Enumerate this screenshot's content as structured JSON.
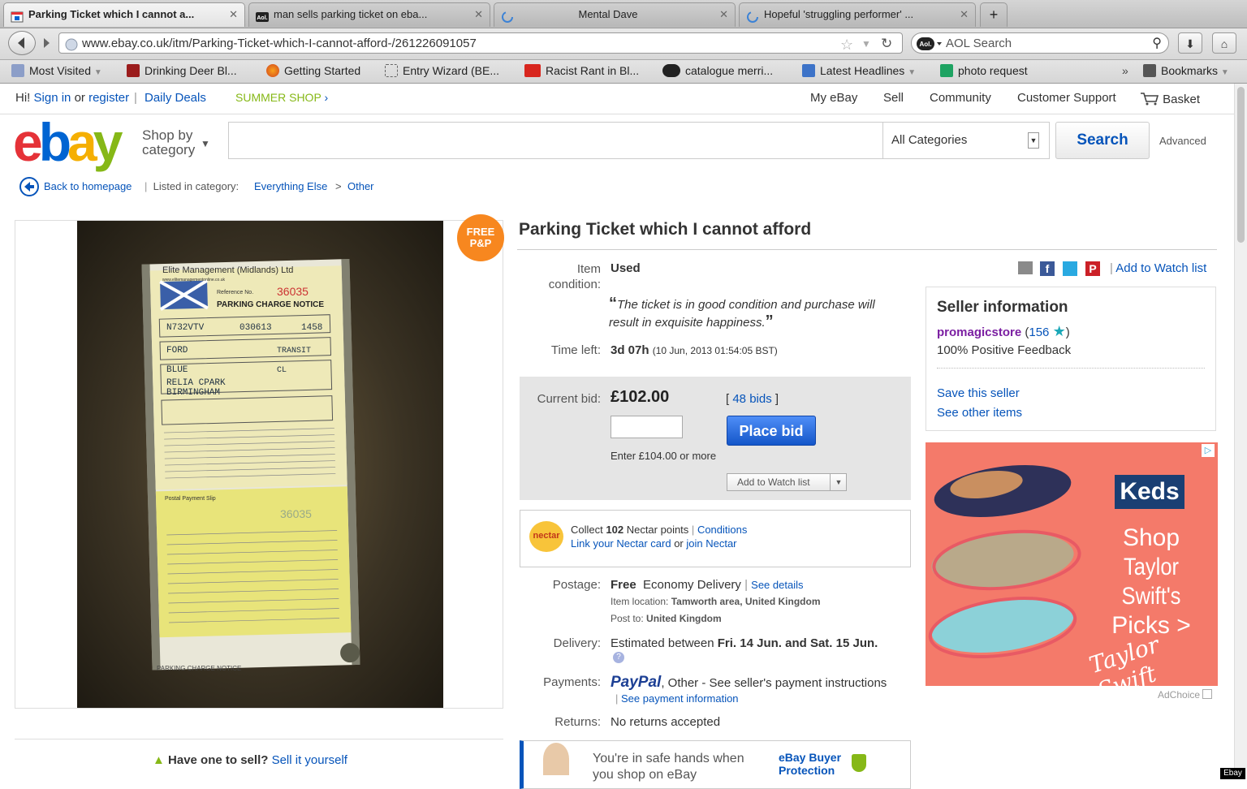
{
  "browser": {
    "tabs": [
      {
        "title": "Parking Ticket which I cannot a...",
        "active": true
      },
      {
        "title": "man sells parking ticket on eba...",
        "active": false
      },
      {
        "title": "Mental Dave",
        "active": false
      },
      {
        "title": "Hopeful 'struggling performer' ...",
        "active": false
      }
    ],
    "new_tab": "+",
    "url": "www.ebay.co.uk/itm/Parking-Ticket-which-I-cannot-afford-/261226091057",
    "search_engine": "AOL Search",
    "bookmarks": [
      {
        "label": "Most Visited",
        "icon": "most-visited-icon",
        "dropdown": true
      },
      {
        "label": "Drinking Deer Bl...",
        "icon": "drinking-deer-icon"
      },
      {
        "label": "Getting Started",
        "icon": "firefox-icon"
      },
      {
        "label": "Entry Wizard (BE...",
        "icon": "page-icon"
      },
      {
        "label": "Racist Rant in Bl...",
        "icon": "youtube-icon"
      },
      {
        "label": "catalogue merri...",
        "icon": "aol-icon"
      },
      {
        "label": "Latest Headlines",
        "icon": "rss-icon",
        "dropdown": true
      },
      {
        "label": "photo request",
        "icon": "sheet-icon"
      }
    ],
    "overflow": "»",
    "bookmarks_menu": "Bookmarks"
  },
  "ebay": {
    "greeting_hi": "Hi!",
    "sign_in": "Sign in",
    "or": "or",
    "register": "register",
    "daily_deals": "Daily Deals",
    "summer_shop": "SUMMER SHOP",
    "right_nav": [
      "My eBay",
      "Sell",
      "Community",
      "Customer Support",
      "Basket"
    ],
    "logo_letters": [
      "e",
      "b",
      "a",
      "y"
    ],
    "shop_by": "Shop by",
    "category": "category",
    "all_categories": "All Categories",
    "search_button": "Search",
    "advanced": "Advanced",
    "back_to_homepage": "Back to homepage",
    "listed_in": "Listed in category:",
    "breadcrumb": [
      "Everything Else",
      "Other"
    ],
    "free_pp": [
      "FREE",
      "P&P"
    ],
    "have_one": "Have one to sell?",
    "sell_it": "Sell it yourself",
    "ticket": {
      "company": "Elite Management (Midlands) Ltd",
      "website": "www.elitemanagementonline.co.uk",
      "reference_label": "Reference No.",
      "reference": "36035",
      "notice": "PARKING CHARGE NOTICE",
      "reg": "N732VTV",
      "date": "030613",
      "time": "1458",
      "make": "FORD",
      "model": "TRANSIT",
      "colour": "BLUE",
      "operative": "CL",
      "location_line1": "RELIA CPARK",
      "location_line2": "BIRMINGHAM",
      "slip_title": "Postal Payment Slip",
      "slip_ref": "36035",
      "footer_notice": "PARKING CHARGE NOTICE"
    }
  },
  "item": {
    "title": "Parking Ticket which I cannot afford",
    "condition_label": "Item condition:",
    "condition_label_1": "Item",
    "condition_label_2": "condition:",
    "condition": "Used",
    "quote_line1": "The ticket is in good condition and purchase will",
    "quote_line2": "result in exquisite happiness.",
    "time_left_label": "Time left:",
    "time_left": "3d 07h",
    "time_left_detail": "(10 Jun, 2013  01:54:05 BST)",
    "current_bid_label": "Current bid:",
    "current_bid": "£102.00",
    "bids_open": "[",
    "bids": "48 bids",
    "bids_close": "]",
    "place_bid": "Place bid",
    "enter_min": "Enter £104.00 or more",
    "add_watch": "Add to Watch list",
    "nectar_logo": "nectar",
    "nectar_collect": "Collect",
    "nectar_points": "102",
    "nectar_points_label": "Nectar points",
    "conditions": "Conditions",
    "link_nectar": "Link your Nectar card",
    "or": "or",
    "join_nectar": "join Nectar",
    "postage_label": "Postage:",
    "postage_free": "Free",
    "postage_type": "Economy Delivery",
    "see_details": "See details",
    "item_location_label": "Item location:",
    "item_location": "Tamworth area, United Kingdom",
    "post_to_label": "Post to:",
    "post_to": "United Kingdom",
    "delivery_label": "Delivery:",
    "delivery_prefix": "Estimated between",
    "delivery_dates": "Fri. 14 Jun. and Sat. 15 Jun.",
    "payments_label": "Payments:",
    "paypal": "PayPal",
    "payments_other": ",  Other - See seller's payment instructions",
    "see_payment": "See payment information",
    "returns_label": "Returns:",
    "returns": "No returns accepted",
    "protection_text1": "You're in safe hands when",
    "protection_text2": "you shop on eBay",
    "protection_brand1": "eBay Buyer",
    "protection_brand2": "Protection"
  },
  "seller": {
    "share_watch": "Add to Watch list",
    "heading": "Seller information",
    "name": "promagicstore",
    "feedback_score": "156",
    "positive": "100% Positive Feedback",
    "save_seller": "Save this seller",
    "see_other": "See other items"
  },
  "ad": {
    "brand": "Keds",
    "line1": "Shop",
    "line2": "Taylor Swift's",
    "line3": "Picks >",
    "signature": "Taylor Swift",
    "adchoice": "AdChoice",
    "bg_color": "#f47a6a"
  },
  "watermark": "Ebay"
}
